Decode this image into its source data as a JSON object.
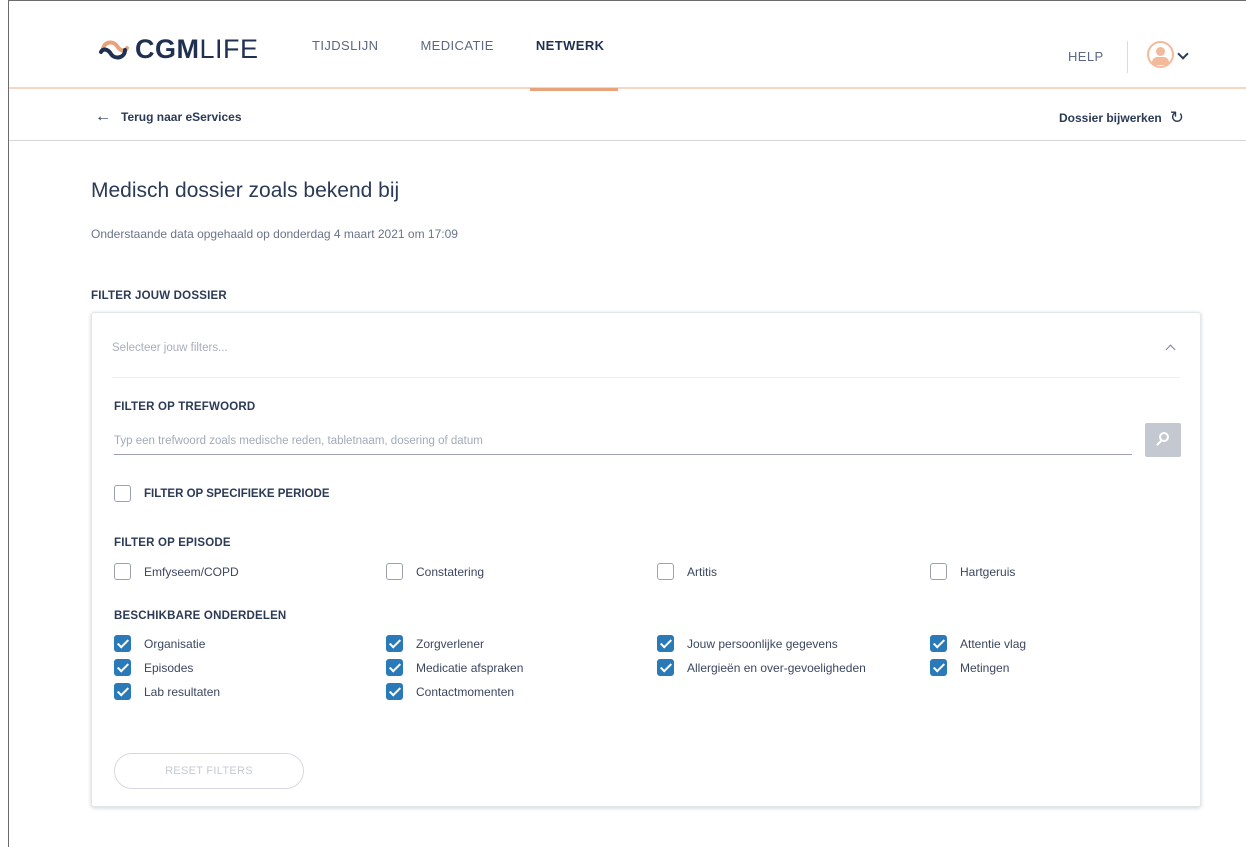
{
  "header": {
    "logo_bold": "CGM",
    "logo_light": "LIFE",
    "nav": [
      "TIJDSLIJN",
      "MEDICATIE",
      "NETWERK"
    ],
    "active_nav": "NETWERK",
    "help": "HELP"
  },
  "subbar": {
    "back": "Terug naar eServices",
    "refresh": "Dossier bijwerken"
  },
  "page": {
    "title": "Medisch dossier zoals bekend bij",
    "subtitle": "Onderstaande data opgehaald op donderdag 4 maart 2021 om 17:09",
    "filter_heading": "FILTER JOUW DOSSIER"
  },
  "filters": {
    "select_placeholder": "Selecteer jouw filters...",
    "keyword_label": "FILTER OP TREFWOORD",
    "keyword_placeholder": "Typ een trefwoord zoals medische reden, tabletnaam, dosering of datum",
    "period_label": "FILTER OP SPECIFIEKE PERIODE",
    "period_checked": false,
    "episode_label": "FILTER OP EPISODE",
    "episodes": [
      {
        "label": "Emfyseem/COPD",
        "checked": false
      },
      {
        "label": "Constatering",
        "checked": false
      },
      {
        "label": "Artitis",
        "checked": false
      },
      {
        "label": "Hartgeruis",
        "checked": false
      }
    ],
    "parts_label": "BESCHIKBARE ONDERDELEN",
    "parts": [
      {
        "label": "Organisatie",
        "checked": true
      },
      {
        "label": "Zorgverlener",
        "checked": true
      },
      {
        "label": "Jouw persoonlijke gegevens",
        "checked": true
      },
      {
        "label": "Attentie vlag",
        "checked": true
      },
      {
        "label": "Episodes",
        "checked": true
      },
      {
        "label": "Medicatie afspraken",
        "checked": true
      },
      {
        "label": "Allergieën en over-gevoeligheden",
        "checked": true
      },
      {
        "label": "Metingen",
        "checked": true
      },
      {
        "label": "Lab resultaten",
        "checked": true
      },
      {
        "label": "Contactmomenten",
        "checked": true
      }
    ],
    "reset_label": "RESET FILTERS"
  },
  "colors": {
    "accent": "#e8a37a",
    "checkbox": "#2a7ab8",
    "text": "#2b3a55"
  }
}
